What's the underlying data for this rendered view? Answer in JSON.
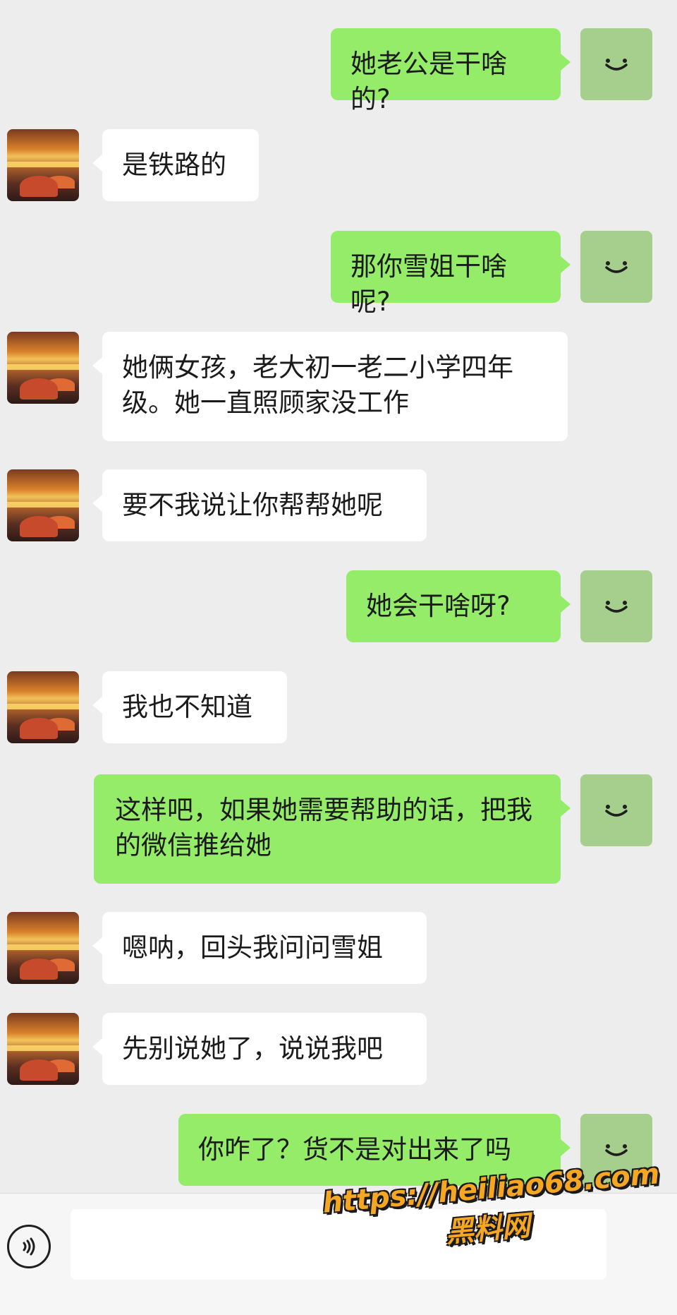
{
  "chat": {
    "messages": [
      {
        "sender": "me",
        "text": "她老公是干啥的?"
      },
      {
        "sender": "other",
        "text": "是铁路的"
      },
      {
        "sender": "me",
        "text": "那你雪姐干啥呢?"
      },
      {
        "sender": "other",
        "text": "她俩女孩，老大初一老二小学四年级。她一直照顾家没工作"
      },
      {
        "sender": "other",
        "text": "要不我说让你帮帮她呢"
      },
      {
        "sender": "me",
        "text": "她会干啥呀?"
      },
      {
        "sender": "other",
        "text": "我也不知道"
      },
      {
        "sender": "me",
        "text": "这样吧，如果她需要帮助的话，把我的微信推给她"
      },
      {
        "sender": "other",
        "text": "嗯呐，回头我问问雪姐"
      },
      {
        "sender": "other",
        "text": "先别说她了，说说我吧"
      },
      {
        "sender": "me",
        "text": "你咋了？货不是对出来了吗"
      }
    ]
  },
  "input_bar": {
    "voice_icon": "voice-icon",
    "message_value": ""
  },
  "watermark": {
    "line1": "https://heiliao68.com",
    "line2": "黑料网"
  },
  "colors": {
    "background": "#ededed",
    "me_bubble": "#95ec69",
    "other_bubble": "#ffffff",
    "me_avatar": "#a6cf8d",
    "watermark": "#f5a623"
  }
}
